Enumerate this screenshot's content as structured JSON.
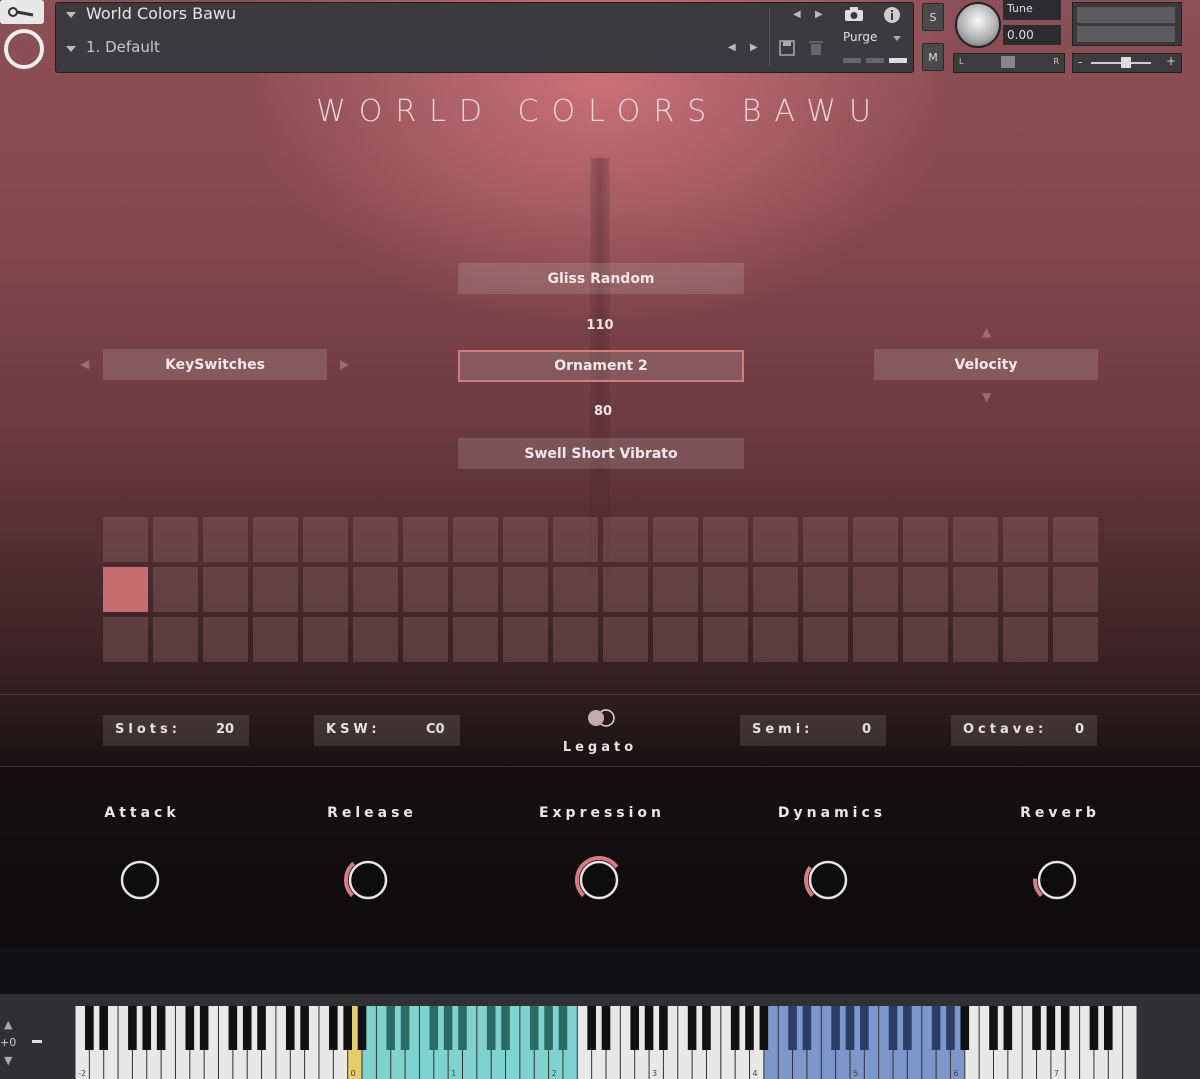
{
  "header": {
    "instrument_name": "World Colors Bawu",
    "preset_name": "1. Default",
    "purge_label": "Purge",
    "solo_label": "S",
    "mute_label": "M",
    "tune_label": "Tune",
    "tune_value": "0.00",
    "pan_left": "L",
    "pan_right": "R",
    "vol_minus": "-",
    "vol_plus": "+"
  },
  "title": "WORLD COLORS BAWU",
  "center": {
    "top_button": "Gliss Random",
    "top_value": "110",
    "selected_button": "Ornament 2",
    "bottom_value": "80",
    "bottom_button": "Swell Short Vibrato"
  },
  "left_selector": {
    "label": "KeySwitches"
  },
  "right_selector": {
    "label": "Velocity"
  },
  "slot_grid": {
    "rows": 3,
    "cols": 20,
    "active_row": 1,
    "active_col": 0
  },
  "fields": {
    "slots_label": "Slots:",
    "slots_value": "20",
    "ksw_label": "KSW:",
    "ksw_value": "C0",
    "legato_label": "Legato",
    "semi_label": "Semi:",
    "semi_value": "0",
    "octave_label": "Octave:",
    "octave_value": "0"
  },
  "knobs": [
    {
      "label": "Attack",
      "value": 0.0
    },
    {
      "label": "Release",
      "value": 0.35
    },
    {
      "label": "Expression",
      "value": 0.7
    },
    {
      "label": "Dynamics",
      "value": 0.3
    },
    {
      "label": "Reverb",
      "value": 0.18
    }
  ],
  "keyboard": {
    "side_value": "+0",
    "octave_labels": [
      "-2",
      "0",
      "1",
      "2",
      "3",
      "4",
      "5",
      "6",
      "7"
    ],
    "colors": {
      "keyswitch": "#7fd3cf",
      "range": "#7b97cc",
      "marker": "#e6cc6a"
    }
  },
  "accent_color": "#d77a82"
}
